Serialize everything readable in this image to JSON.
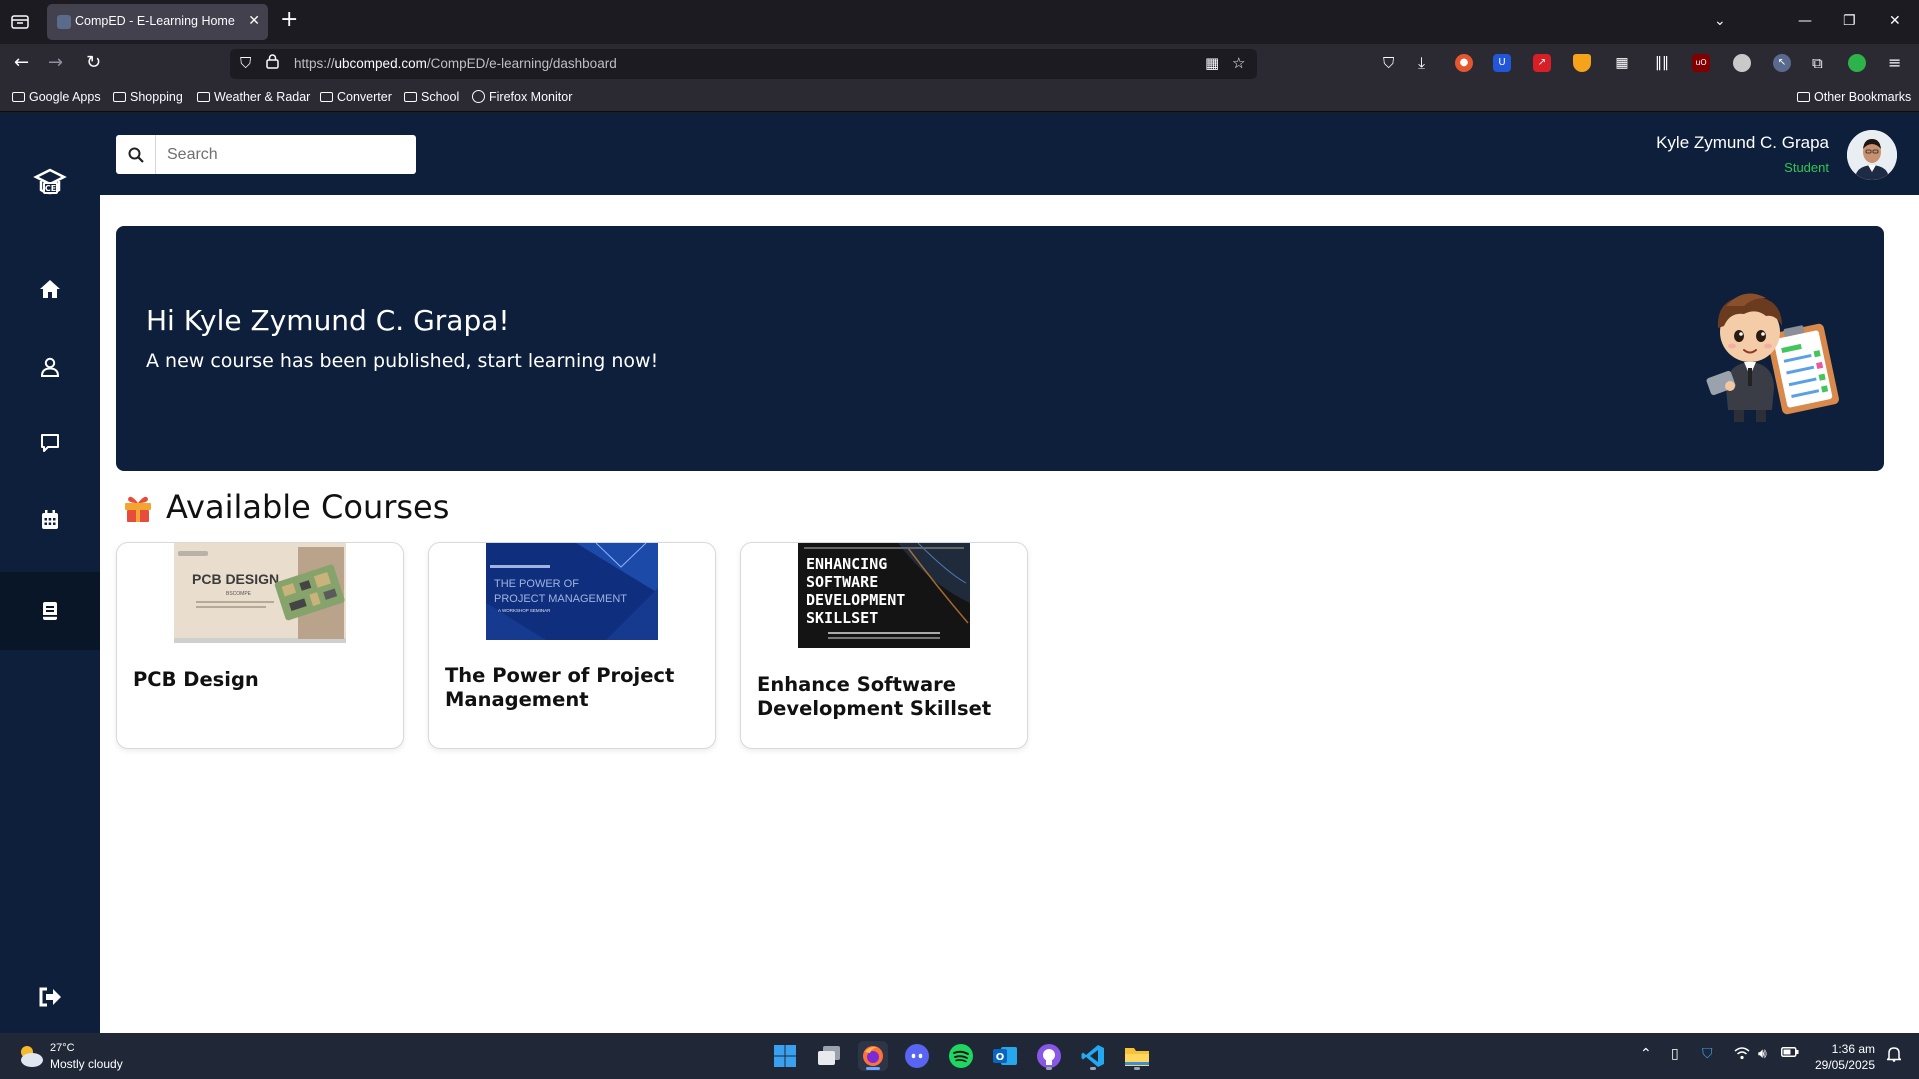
{
  "browser": {
    "tab_title": "CompED - E-Learning Home",
    "url_prefix": "https://",
    "url_domain": "ubcomped.com",
    "url_path": "/CompED/e-learning/dashboard",
    "bookmarks": [
      "Google Apps",
      "Shopping",
      "Weather & Radar",
      "Converter",
      "School",
      "Firefox Monitor"
    ],
    "other_bookmarks": "Other Bookmarks"
  },
  "header": {
    "search_placeholder": "Search",
    "user_name": "Kyle Zymund C. Grapa",
    "user_role": "Student"
  },
  "sidebar": {
    "items": [
      {
        "icon": "home-icon"
      },
      {
        "icon": "user-icon"
      },
      {
        "icon": "chat-icon"
      },
      {
        "icon": "calendar-icon"
      },
      {
        "icon": "book-icon",
        "active": true
      }
    ],
    "logout_icon": "logout-icon"
  },
  "banner": {
    "greeting": "Hi Kyle Zymund C. Grapa!",
    "message": "A new course has been published, start learning now!"
  },
  "courses": {
    "heading": "Available Courses",
    "items": [
      {
        "title": "PCB Design",
        "thumb_title": "PCB DESIGN",
        "thumb_sub": "BSCOMPE"
      },
      {
        "title": "The Power of Project Management",
        "thumb_title_1": "THE POWER OF",
        "thumb_title_2": "PROJECT MANAGEMENT",
        "thumb_sub": "A WORKSHOP SEMINAR"
      },
      {
        "title": "Enhance Software Development Skillset",
        "thumb_lines": [
          "ENHANCING",
          "SOFTWARE",
          "DEVELOPMENT",
          "SKILLSET"
        ]
      }
    ]
  },
  "taskbar": {
    "weather_temp": "27°C",
    "weather_desc": "Mostly cloudy",
    "time": "1:36 am",
    "date": "29/05/2025"
  },
  "colors": {
    "navy": "#0d1f3a",
    "role_green": "#31c653"
  }
}
